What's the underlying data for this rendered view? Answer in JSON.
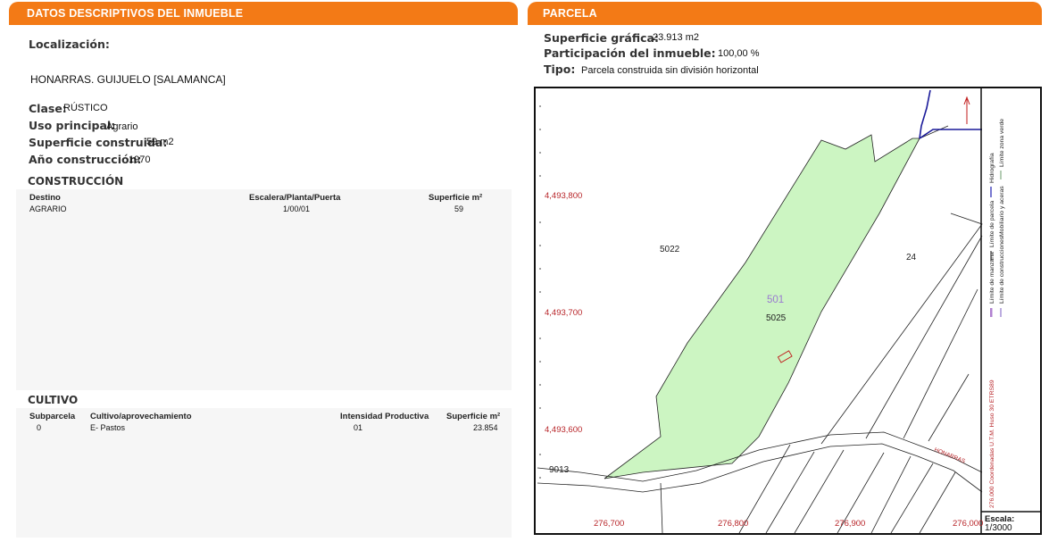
{
  "left": {
    "title": "DATOS DESCRIPTIVOS DEL INMUEBLE",
    "localizacion_label": "Localización:",
    "address": "HONARRAS. GUIJUELO [SALAMANCA]",
    "clase_label": "Clase:",
    "clase_value": "RÚSTICO",
    "uso_label": "Uso principal:",
    "uso_value": "Agrario",
    "superficie_label": "Superficie construida:",
    "superficie_value": "59 m2",
    "anio_label": "Año construcción:",
    "anio_value": "1970",
    "construccion": {
      "title": "CONSTRUCCIÓN",
      "headers": [
        "Destino",
        "Escalera/Planta/Puerta",
        "Superficie m²"
      ],
      "rows": [
        [
          "AGRARIO",
          "1/00/01",
          "59"
        ]
      ]
    },
    "cultivo": {
      "title": "CULTIVO",
      "headers": [
        "Subparcela",
        "Cultivo/aprovechamiento",
        "Intensidad Productiva",
        "Superficie m²"
      ],
      "rows": [
        [
          "0",
          "E- Pastos",
          "01",
          "23.854"
        ]
      ]
    }
  },
  "right": {
    "title": "PARCELA",
    "superficie_label": "Superficie gráfica:",
    "superficie_value": "23.913 m2",
    "participacion_label": "Participación del inmueble:",
    "participacion_value": "100,00 %",
    "tipo_label": "Tipo:",
    "tipo_value": "Parcela construida sin división horizontal",
    "map": {
      "y_coords": [
        "4,493,800",
        "4,493,700",
        "4,493,600"
      ],
      "x_coords": [
        "276,700",
        "276,800",
        "276,900",
        "276,000"
      ],
      "parcel_labels": [
        "5022",
        "24",
        "501",
        "5025",
        "9013"
      ],
      "road_label": "HONARRAS",
      "legend": {
        "col1": [
          "Hidrografía",
          "Límite de parcela",
          "Límite de manzana",
          "276.000 Coordenadas U.T.M. Huso 30 ETRS89"
        ],
        "col2": [
          "Límite zona verde",
          "Mobiliario y aceras",
          "Límite de construcciones"
        ]
      },
      "scale_label": "Escala:",
      "scale_value": "1/3000"
    },
    "colors": {
      "parcel_fill": "#ccf5c2",
      "accent": "#f37a16",
      "coord_red": "#b8262a",
      "water_blue": "#1a1a9a"
    }
  }
}
